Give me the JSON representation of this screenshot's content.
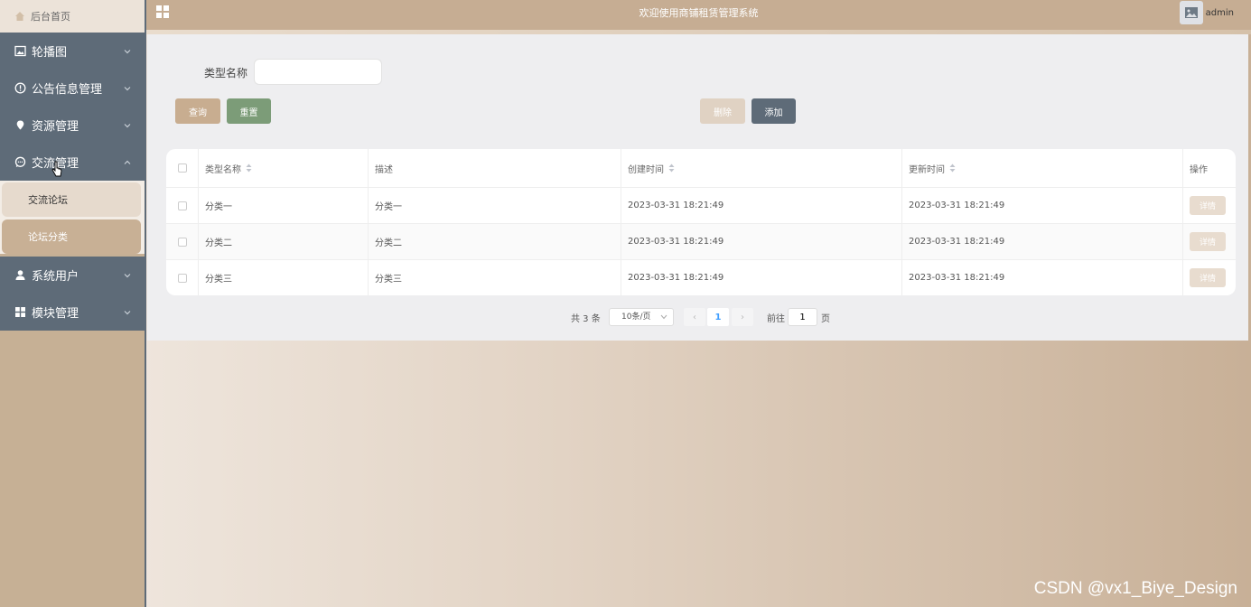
{
  "sidebar": {
    "home": "后台首页",
    "menu": [
      {
        "label": "轮播图",
        "icon": "image-icon"
      },
      {
        "label": "公告信息管理",
        "icon": "info-circle-icon"
      },
      {
        "label": "资源管理",
        "icon": "location-pin-icon"
      },
      {
        "label": "交流管理",
        "icon": "chat-bubble-icon",
        "expanded": true
      }
    ],
    "submenu": [
      {
        "label": "交流论坛",
        "active": false
      },
      {
        "label": "论坛分类",
        "active": true
      }
    ],
    "menu_after": [
      {
        "label": "系统用户",
        "icon": "user-icon"
      },
      {
        "label": "模块管理",
        "icon": "grid-icon"
      }
    ]
  },
  "header": {
    "title": "欢迎使用商铺租赁管理系统",
    "user": "admin"
  },
  "search": {
    "label": "类型名称",
    "value": "",
    "placeholder": ""
  },
  "buttons": {
    "query": "查询",
    "reset": "重置",
    "delete": "删除",
    "add": "添加"
  },
  "table": {
    "columns": [
      "类型名称",
      "描述",
      "创建时间",
      "更新时间",
      "操作"
    ],
    "rows": [
      {
        "name": "分类一",
        "desc": "分类一",
        "created": "2023-03-31 18:21:49",
        "updated": "2023-03-31 18:21:49",
        "action": "详情"
      },
      {
        "name": "分类二",
        "desc": "分类二",
        "created": "2023-03-31 18:21:49",
        "updated": "2023-03-31 18:21:49",
        "action": "详情"
      },
      {
        "name": "分类三",
        "desc": "分类三",
        "created": "2023-03-31 18:21:49",
        "updated": "2023-03-31 18:21:49",
        "action": "详情"
      }
    ]
  },
  "pagination": {
    "total": "共 3 条",
    "page_size": "10条/页",
    "prev": "‹",
    "current": "1",
    "next": "›",
    "goto_label": "前往",
    "goto_value": "1",
    "page_suffix": "页"
  },
  "watermark": "CSDN @vx1_Biye_Design",
  "colors": {
    "sidebar_menu": "#5e6b78",
    "topbar": "#c6ad93",
    "accent_tan": "#c8ad90",
    "accent_green": "#7c9c78"
  }
}
